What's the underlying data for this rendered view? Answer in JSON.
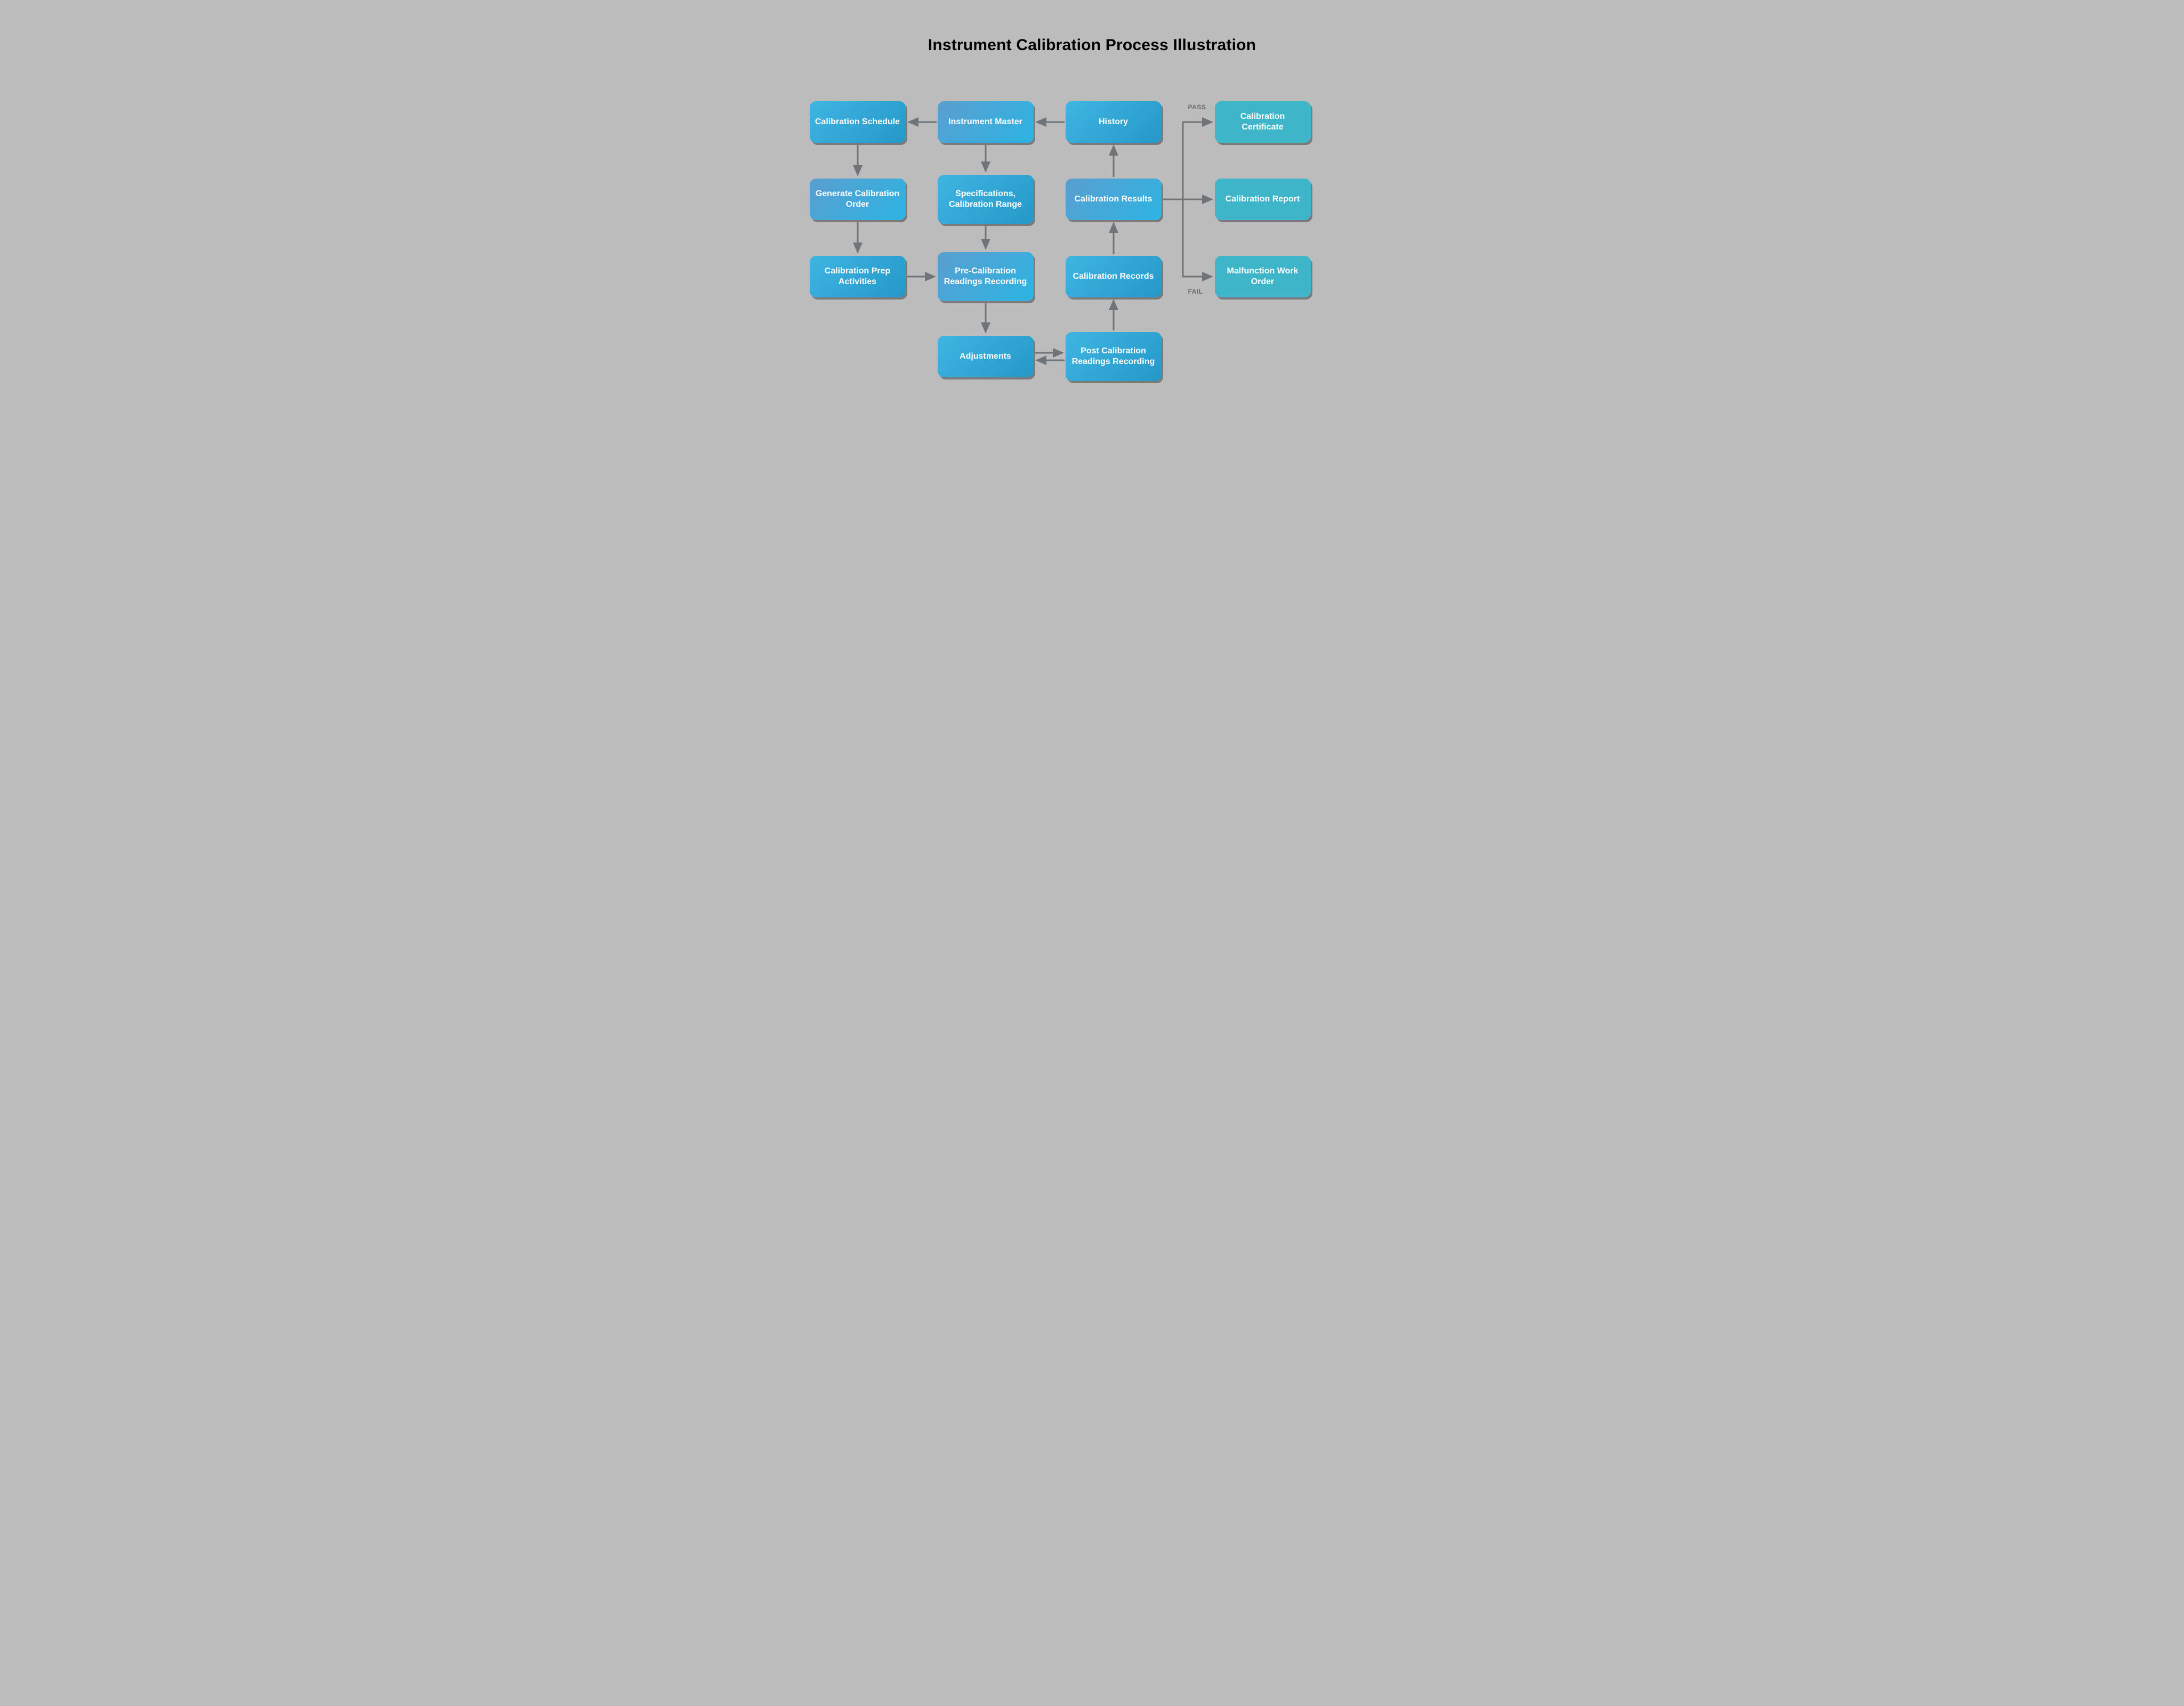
{
  "title": "Instrument Calibration Process Illustration",
  "nodes": {
    "calibration_schedule": "Calibration Schedule",
    "instrument_master": "Instrument Master",
    "history": "History",
    "calibration_certificate": "Calibration Certificate",
    "generate_calibration_order": "Generate Calibration Order",
    "specifications_calibration_range": "Specifications, Calibration Range",
    "calibration_results": "Calibration Results",
    "calibration_report": "Calibration Report",
    "calibration_prep_activities": "Calibration Prep Activities",
    "pre_calibration_readings_recording": "Pre-Calibration Readings Recording",
    "calibration_records": "Calibration Records",
    "malfunction_work_order": "Malfunction Work Order",
    "adjustments": "Adjustments",
    "post_calibration_readings_recording": "Post Calibration Readings Recording"
  },
  "labels": {
    "pass": "PASS",
    "fail": "FAIL"
  },
  "colors": {
    "arrow": "#6f7478",
    "label": "#6b6b6b"
  }
}
